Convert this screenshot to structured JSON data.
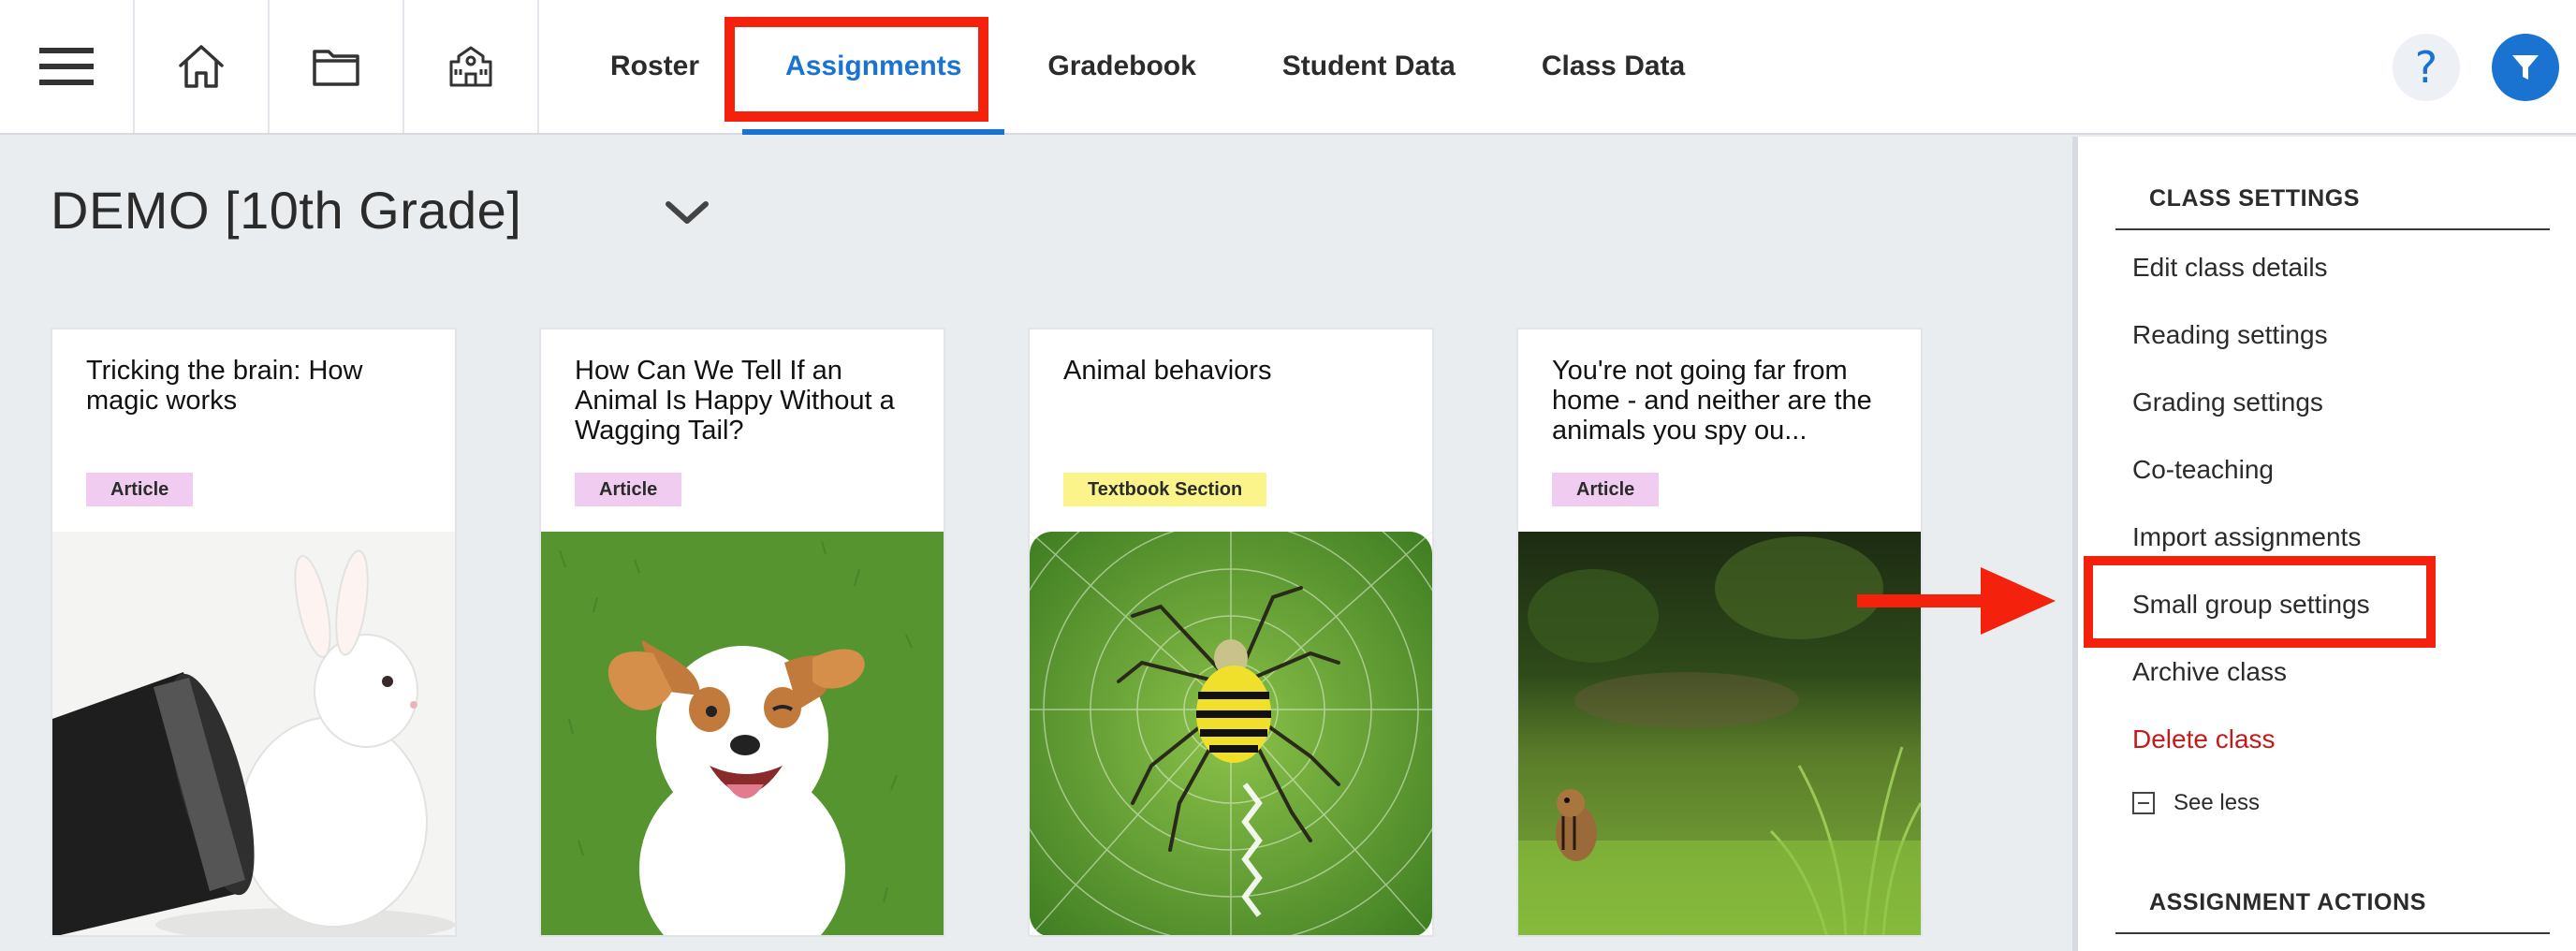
{
  "nav": {
    "icons": [
      "menu-icon",
      "home-icon",
      "folder-icon",
      "school-icon"
    ],
    "tabs": [
      {
        "label": "Roster",
        "active": false
      },
      {
        "label": "Assignments",
        "active": true
      },
      {
        "label": "Gradebook",
        "active": false
      },
      {
        "label": "Student Data",
        "active": false
      },
      {
        "label": "Class Data",
        "active": false
      }
    ],
    "help_label": "?",
    "accent_color": "#1a73d1"
  },
  "class_selector": {
    "title": "DEMO [10th Grade]"
  },
  "cards": [
    {
      "title": "Tricking the brain: How magic works",
      "badge": "Article",
      "image": "rabbit-in-top-hat"
    },
    {
      "title": "How Can We Tell If an Animal Is Happy Without a Wagging Tail?",
      "badge": "Article",
      "image": "dog-on-grass"
    },
    {
      "title": "Animal behaviors",
      "badge": "Textbook Section",
      "image": "spider-on-web"
    },
    {
      "title": "You're not going far from home - and neither are the animals you spy ou...",
      "badge": "Article",
      "image": "chipmunk-in-grass"
    }
  ],
  "side_panel": {
    "class_settings_heading": "CLASS SETTINGS",
    "items": [
      {
        "label": "Edit class details"
      },
      {
        "label": "Reading settings"
      },
      {
        "label": "Grading settings"
      },
      {
        "label": "Co-teaching"
      },
      {
        "label": "Import assignments"
      },
      {
        "label": "Small group settings"
      },
      {
        "label": "Archive class"
      },
      {
        "label": "Delete class"
      }
    ],
    "see_less": "See less",
    "assignment_actions_heading": "ASSIGNMENT ACTIONS"
  },
  "annotation_color": "#f4210c"
}
